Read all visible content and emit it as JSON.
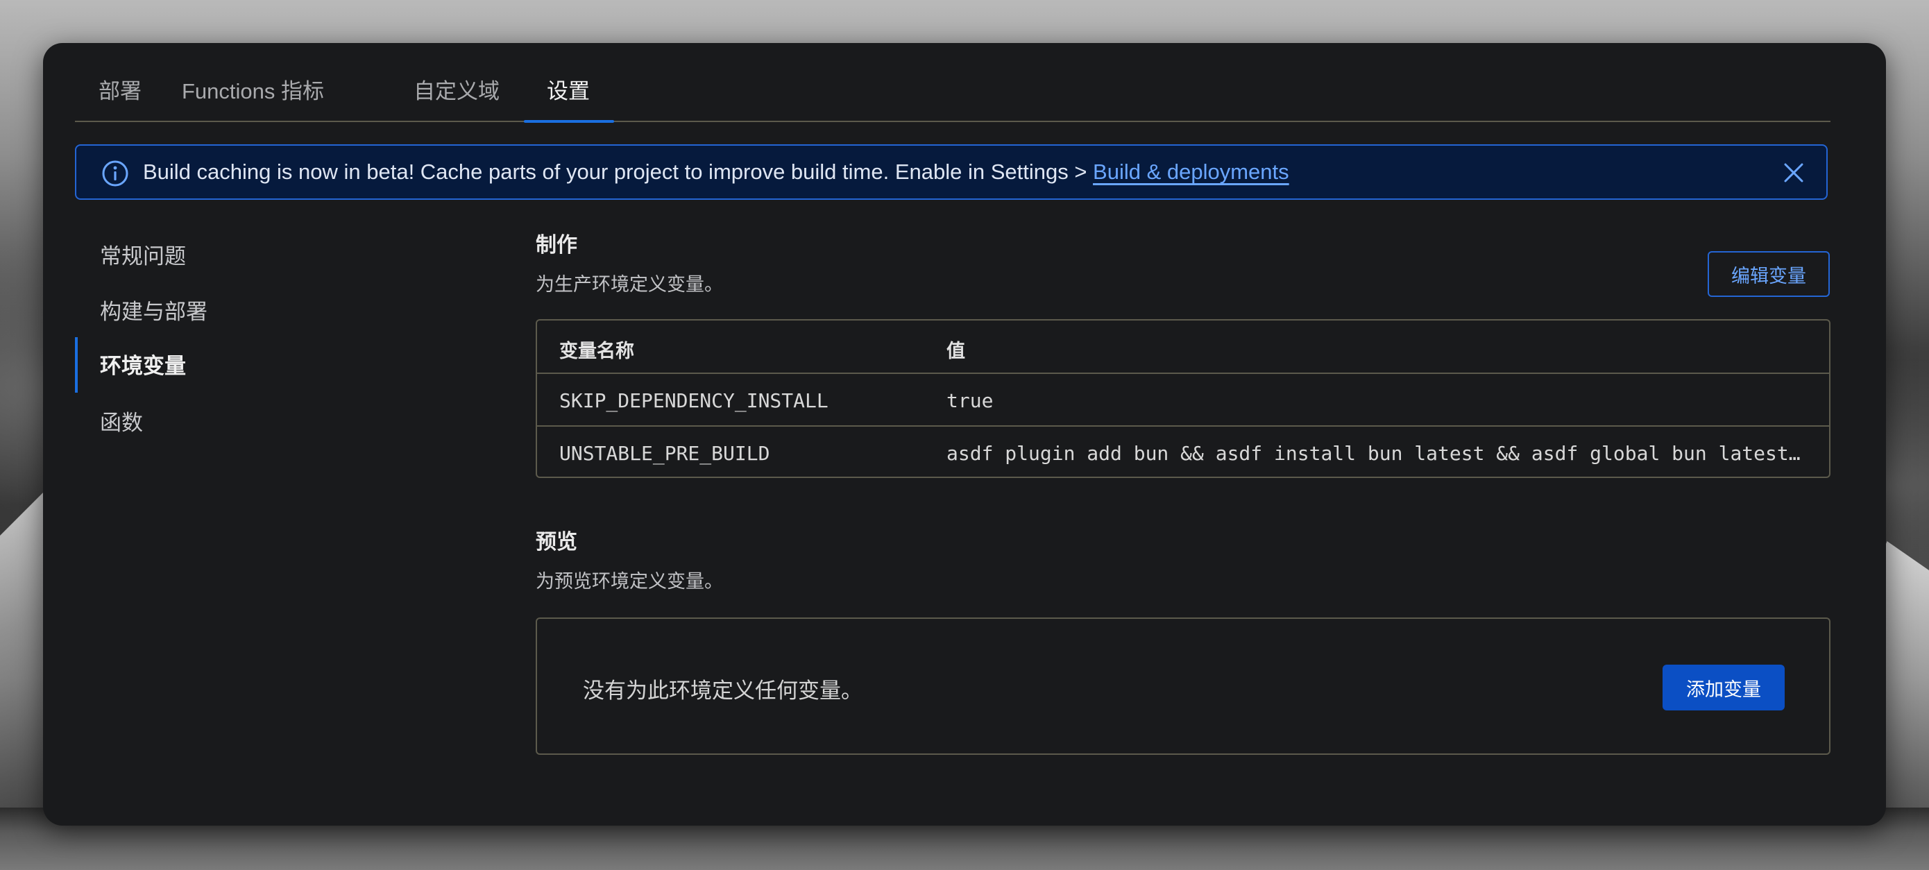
{
  "tabs": [
    {
      "label": "部署"
    },
    {
      "label": "Functions 指标"
    },
    {
      "label": "自定义域"
    },
    {
      "label": "设置",
      "active": true
    }
  ],
  "banner": {
    "text": "Build caching is now in beta! Cache parts of your project to improve build time. Enable in Settings > ",
    "link": "Build & deployments",
    "icon": "info-icon",
    "close_icon": "close-icon"
  },
  "sidebar": {
    "items": [
      {
        "label": "常规问题"
      },
      {
        "label": "构建与部署"
      },
      {
        "label": "环境变量",
        "active": true
      },
      {
        "label": "函数"
      }
    ]
  },
  "production": {
    "title": "制作",
    "description": "为生产环境定义变量。",
    "edit_button": "编辑变量",
    "table": {
      "headers": [
        "变量名称",
        "值"
      ],
      "rows": [
        {
          "name": "SKIP_DEPENDENCY_INSTALL",
          "value": "true"
        },
        {
          "name": "UNSTABLE_PRE_BUILD",
          "value": "asdf plugin add bun && asdf install bun latest && asdf global bun latest…"
        }
      ]
    }
  },
  "preview": {
    "title": "预览",
    "description": "为预览环境定义变量。",
    "empty_text": "没有为此环境定义任何变量。",
    "add_button": "添加变量"
  },
  "colors": {
    "accent": "#1a6fe0",
    "banner_bg": "#061a3d",
    "link": "#6aa6ff",
    "window_bg": "#191a1c",
    "primary_button": "#0b4fc4"
  }
}
